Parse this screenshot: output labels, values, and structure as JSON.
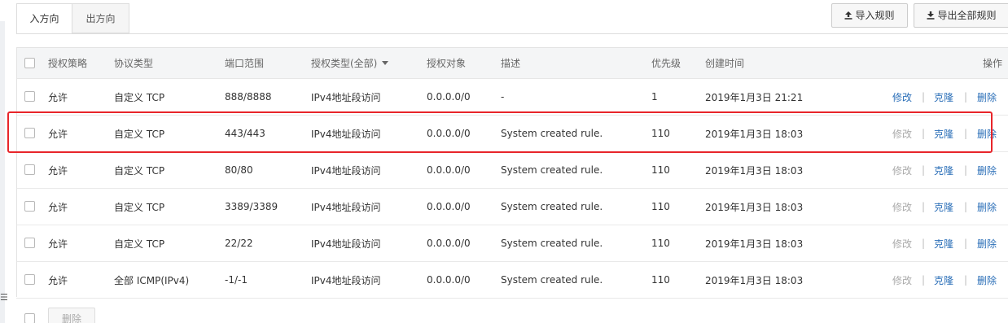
{
  "tabs": [
    {
      "label": "入方向",
      "active": true
    },
    {
      "label": "出方向",
      "active": false
    }
  ],
  "toolbar": {
    "import_label": "导入规则",
    "export_label": "导出全部规则"
  },
  "table": {
    "headers": {
      "policy": "授权策略",
      "protocol": "协议类型",
      "port": "端口范围",
      "auth_type": "授权类型(全部)",
      "object": "授权对象",
      "desc": "描述",
      "priority": "优先级",
      "created": "创建时间",
      "ops": "操作"
    },
    "rows": [
      {
        "policy": "允许",
        "protocol": "自定义 TCP",
        "port": "888/8888",
        "auth_type": "IPv4地址段访问",
        "object": "0.0.0.0/0",
        "desc": "-",
        "priority": "1",
        "created": "2019年1月3日 21:21",
        "edit": "修改",
        "clone": "克隆",
        "delete": "删除"
      },
      {
        "policy": "允许",
        "protocol": "自定义 TCP",
        "port": "443/443",
        "auth_type": "IPv4地址段访问",
        "object": "0.0.0.0/0",
        "desc": "System created rule.",
        "priority": "110",
        "created": "2019年1月3日 18:03",
        "edit": "修改",
        "clone": "克隆",
        "delete": "删除"
      },
      {
        "policy": "允许",
        "protocol": "自定义 TCP",
        "port": "80/80",
        "auth_type": "IPv4地址段访问",
        "object": "0.0.0.0/0",
        "desc": "System created rule.",
        "priority": "110",
        "created": "2019年1月3日 18:03",
        "edit": "修改",
        "clone": "克隆",
        "delete": "删除"
      },
      {
        "policy": "允许",
        "protocol": "自定义 TCP",
        "port": "3389/3389",
        "auth_type": "IPv4地址段访问",
        "object": "0.0.0.0/0",
        "desc": "System created rule.",
        "priority": "110",
        "created": "2019年1月3日 18:03",
        "edit": "修改",
        "clone": "克隆",
        "delete": "删除"
      },
      {
        "policy": "允许",
        "protocol": "自定义 TCP",
        "port": "22/22",
        "auth_type": "IPv4地址段访问",
        "object": "0.0.0.0/0",
        "desc": "System created rule.",
        "priority": "110",
        "created": "2019年1月3日 18:03",
        "edit": "修改",
        "clone": "克隆",
        "delete": "删除"
      },
      {
        "policy": "允许",
        "protocol": "全部 ICMP(IPv4)",
        "port": "-1/-1",
        "auth_type": "IPv4地址段访问",
        "object": "0.0.0.0/0",
        "desc": "System created rule.",
        "priority": "110",
        "created": "2019年1月3日 18:03",
        "edit": "修改",
        "clone": "克隆",
        "delete": "删除"
      }
    ],
    "separator": "|"
  },
  "footer": {
    "delete_label": "删除"
  },
  "colors": {
    "link": "#2b6fb8",
    "disabled": "#aaaaaa",
    "highlight": "#e8252a",
    "header_bg": "#f4f5f6"
  },
  "icons": {
    "import": "upload-icon",
    "export": "download-icon",
    "sort": "caret-down-icon"
  }
}
